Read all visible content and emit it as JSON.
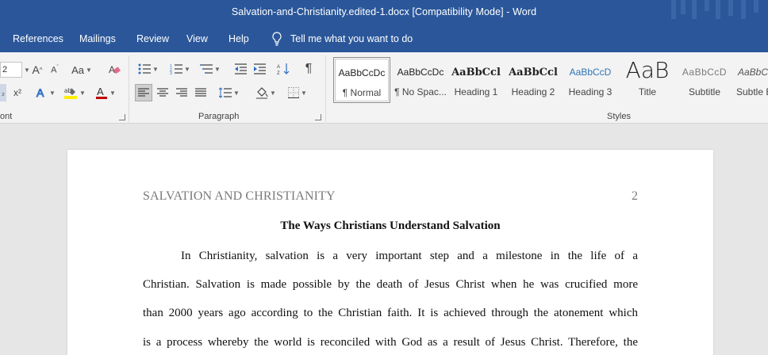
{
  "titlebar": {
    "title": "Salvation-and-Christianity.edited-1.docx [Compatibility Mode]  -  Word"
  },
  "menu": {
    "tabs": [
      "References",
      "Mailings",
      "Review",
      "View",
      "Help"
    ],
    "tell_me": "Tell me what you want to do"
  },
  "ribbon": {
    "font_size": "2",
    "font_label": "ont",
    "paragraph_label": "Paragraph",
    "styles_label": "Styles",
    "grow_font": "A",
    "change_case": "Aa",
    "superscript": "x²",
    "styles": [
      {
        "sample": "AaBbCcDc",
        "name": "¶ Normal"
      },
      {
        "sample": "AaBbCcDc",
        "name": "¶ No Spac..."
      },
      {
        "sample": "AaBbCcl",
        "name": "Heading 1"
      },
      {
        "sample": "AaBbCcl",
        "name": "Heading 2"
      },
      {
        "sample": "AaBbCcD",
        "name": "Heading 3"
      },
      {
        "sample": "AaB",
        "name": "Title"
      },
      {
        "sample": "AaBbCcD",
        "name": "Subtitle"
      },
      {
        "sample": "AaBbC",
        "name": "Subtle E"
      }
    ]
  },
  "document": {
    "running_head": "SALVATION AND CHRISTIANITY",
    "page_number": "2",
    "title": "The Ways Christians Understand Salvation",
    "lines": [
      "In Christianity, salvation is a very important step and a milestone in the life of a",
      "Christian. Salvation is made possible by the death of Jesus Christ when he was crucified more",
      "than 2000 years ago according to the Christian faith. It is achieved through the atonement which",
      "is a process whereby the world is reconciled with God as a result of Jesus Christ.  Therefore, the"
    ]
  },
  "colors": {
    "brand_blue": "#2b579a",
    "ribbon_bg": "#f3f3f3",
    "canvas_bg": "#e6e6e6"
  }
}
